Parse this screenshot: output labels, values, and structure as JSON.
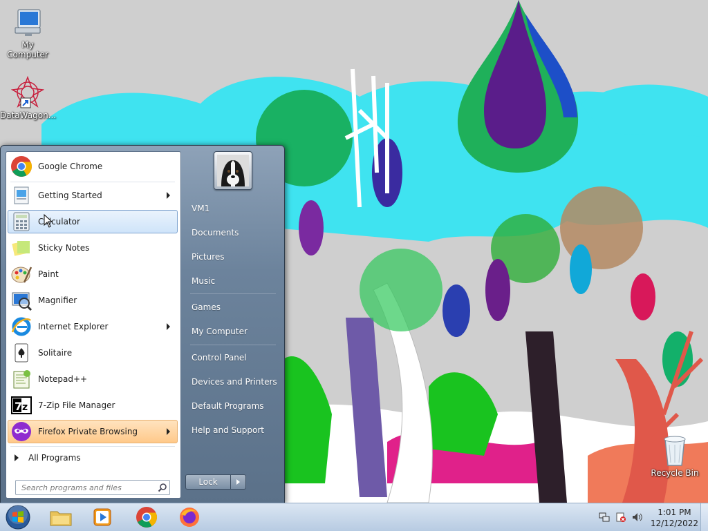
{
  "desktop": {
    "icons": [
      {
        "label": "My Computer",
        "icon": "computer-icon"
      },
      {
        "label": "DataWagon...",
        "icon": "datawagon-shortcut-icon"
      },
      {
        "label": "Recycle Bin",
        "icon": "recycle-bin-icon"
      }
    ]
  },
  "start_menu": {
    "programs": [
      {
        "label": "Google Chrome",
        "icon": "chrome-icon",
        "has_submenu": false
      },
      {
        "label": "Getting Started",
        "icon": "getting-started-icon",
        "has_submenu": true
      },
      {
        "label": "Calculator",
        "icon": "calculator-icon",
        "has_submenu": false,
        "state": "hover"
      },
      {
        "label": "Sticky Notes",
        "icon": "sticky-notes-icon",
        "has_submenu": false
      },
      {
        "label": "Paint",
        "icon": "paint-icon",
        "has_submenu": false
      },
      {
        "label": "Magnifier",
        "icon": "magnifier-icon",
        "has_submenu": false
      },
      {
        "label": "Internet Explorer",
        "icon": "internet-explorer-icon",
        "has_submenu": true
      },
      {
        "label": "Solitaire",
        "icon": "solitaire-icon",
        "has_submenu": false
      },
      {
        "label": "Notepad++",
        "icon": "notepadpp-icon",
        "has_submenu": false
      },
      {
        "label": "7-Zip File Manager",
        "icon": "7zip-icon",
        "has_submenu": false
      },
      {
        "label": "Firefox Private Browsing",
        "icon": "firefox-private-icon",
        "has_submenu": true,
        "state": "highlight"
      }
    ],
    "all_programs_label": "All Programs",
    "search_placeholder": "Search programs and files",
    "right_links": [
      {
        "label": "VM1"
      },
      {
        "label": "Documents"
      },
      {
        "label": "Pictures"
      },
      {
        "label": "Music"
      },
      {
        "label": "Games"
      },
      {
        "label": "My Computer"
      },
      {
        "label": "Control Panel"
      },
      {
        "label": "Devices and Printers"
      },
      {
        "label": "Default Programs"
      },
      {
        "label": "Help and Support"
      }
    ],
    "shutdown_label": "Lock"
  },
  "taskbar": {
    "pinned": [
      {
        "name": "file-explorer",
        "icon": "folder-icon"
      },
      {
        "name": "media-player",
        "icon": "media-player-icon"
      },
      {
        "name": "chrome",
        "icon": "chrome-icon"
      },
      {
        "name": "firefox",
        "icon": "firefox-icon"
      }
    ],
    "clock_time": "1:01 PM",
    "clock_date": "12/12/2022"
  },
  "colors": {
    "highlight": "#ffc98a",
    "hover": "#cfe4fa",
    "taskbar": "#c6d6ea"
  }
}
